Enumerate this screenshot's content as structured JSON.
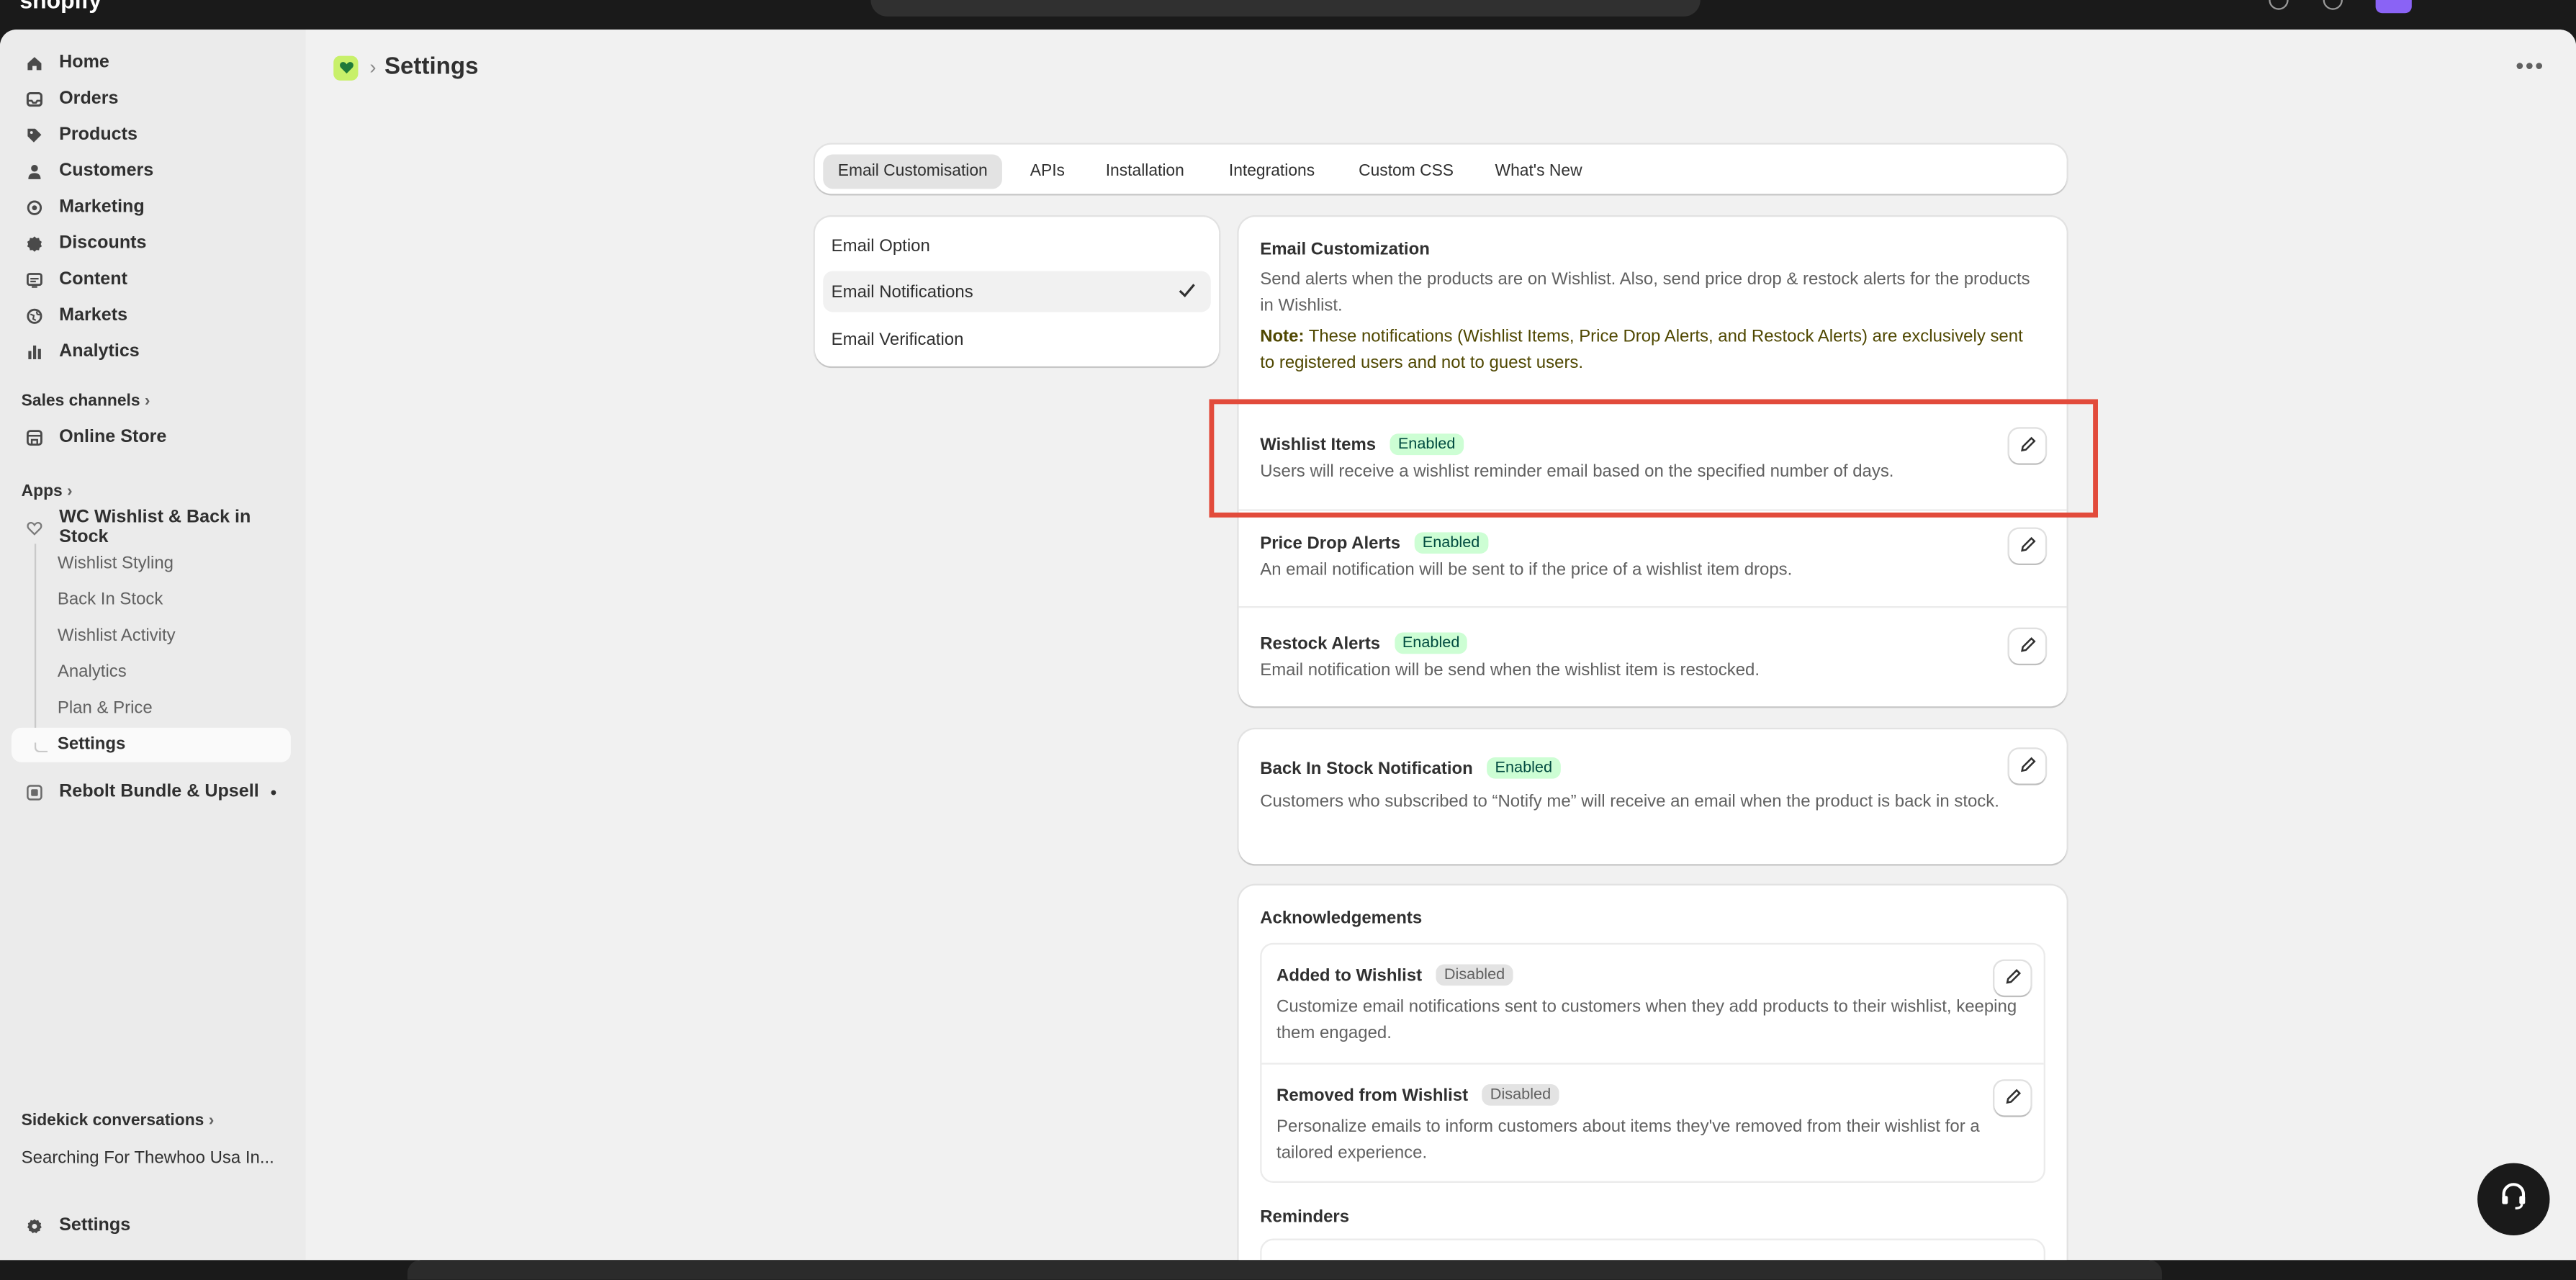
{
  "topbar": {
    "logo": "shopify"
  },
  "sidebar": {
    "nav": [
      {
        "label": "Home",
        "icon": "home-icon"
      },
      {
        "label": "Orders",
        "icon": "inbox-icon"
      },
      {
        "label": "Products",
        "icon": "tag-icon"
      },
      {
        "label": "Customers",
        "icon": "person-icon"
      },
      {
        "label": "Marketing",
        "icon": "target-icon"
      },
      {
        "label": "Discounts",
        "icon": "discount-icon"
      },
      {
        "label": "Content",
        "icon": "content-icon"
      },
      {
        "label": "Markets",
        "icon": "globe-icon"
      },
      {
        "label": "Analytics",
        "icon": "bar-chart-icon"
      }
    ],
    "sales_channels_label": "Sales channels",
    "online_store": "Online Store",
    "apps_label": "Apps",
    "app_name": "WC Wishlist & Back in Stock",
    "app_sub": [
      "Wishlist Styling",
      "Back In Stock",
      "Wishlist Activity",
      "Analytics",
      "Plan & Price",
      "Settings"
    ],
    "other_app": "Rebolt Bundle & Upsell",
    "sidekick_label": "Sidekick conversations",
    "sidekick_item": "Searching For Thewhoo Usa In...",
    "settings": "Settings"
  },
  "header": {
    "title": "Settings",
    "more": "•••"
  },
  "tabs": [
    "Email Customisation",
    "APIs",
    "Installation",
    "Integrations",
    "Custom CSS",
    "What's New"
  ],
  "options": [
    "Email Option",
    "Email Notifications",
    "Email Verification"
  ],
  "email_customization": {
    "title": "Email Customization",
    "description": "Send alerts when the products are on Wishlist. Also, send price drop & restock alerts for the products in Wishlist.",
    "note_label": "Note:",
    "note_text": "These notifications (Wishlist Items, Price Drop Alerts, and Restock Alerts) are exclusively sent to registered users and not to guest users."
  },
  "alerts": [
    {
      "title": "Wishlist Items",
      "status": "Enabled",
      "desc": "Users will receive a wishlist reminder email based on the specified number of days."
    },
    {
      "title": "Price Drop Alerts",
      "status": "Enabled",
      "desc": "An email notification will be sent to if the price of a wishlist item drops."
    },
    {
      "title": "Restock Alerts",
      "status": "Enabled",
      "desc": "Email notification will be send when the wishlist item is restocked."
    }
  ],
  "back_in_stock": {
    "title": "Back In Stock Notification",
    "status": "Enabled",
    "desc": "Customers who subscribed to “Notify me” will receive an email when the product is back in stock."
  },
  "acknowledgements": {
    "title": "Acknowledgements",
    "items": [
      {
        "title": "Added to Wishlist",
        "status": "Disabled",
        "desc": "Customize email notifications sent to customers when they add products to their wishlist, keeping them engaged."
      },
      {
        "title": "Removed from Wishlist",
        "status": "Disabled",
        "desc": "Personalize emails to inform customers about items they've removed from their wishlist for a tailored experience."
      }
    ]
  },
  "reminders": {
    "title": "Reminders"
  },
  "colors": {
    "highlight": "#e24b3b",
    "enabled_badge": "#cdfed4",
    "accent": "#8a63f5"
  }
}
